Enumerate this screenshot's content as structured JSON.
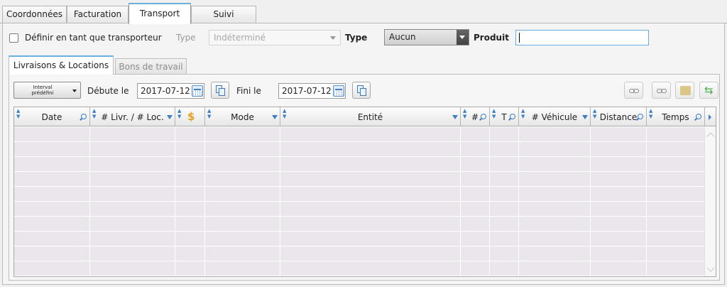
{
  "tabs": {
    "coordonnees": "Coordonnées",
    "facturation": "Facturation",
    "transport": "Transport",
    "suivi": "Suivi"
  },
  "row1": {
    "checkbox_label": "Définir en tant que transporteur",
    "checkbox_checked": false,
    "type_label_disabled": "Type",
    "type_value_disabled": "Indéterminé",
    "type_label": "Type",
    "type_value": "Aucun",
    "produit_label": "Produit",
    "produit_value": ""
  },
  "subtabs": {
    "livraisons": "Livraisons & Locations",
    "bons": "Bons de travail"
  },
  "toolbar": {
    "interval_line1": "Interval",
    "interval_line2": "prédéfini",
    "debute_label": "Débute le",
    "debute_value": "2017-07-12",
    "fini_label": "Fini le",
    "fini_value": "2017-07-12"
  },
  "grid": {
    "columns": {
      "date": "Date",
      "livr_loc": "# Livr. / # Loc.",
      "mode": "Mode",
      "entite": "Entité",
      "num": "#",
      "t": "T",
      "vehicule": "# Véhicule",
      "distance": "Distance",
      "temps": "Temps"
    },
    "row_count": 10
  },
  "colors": {
    "accent": "#6ab0de",
    "row_fill": "#ebe6eb",
    "icon_blue": "#3d7fc4",
    "coin": "#e0a21e",
    "refresh_green": "#4cae4c"
  }
}
